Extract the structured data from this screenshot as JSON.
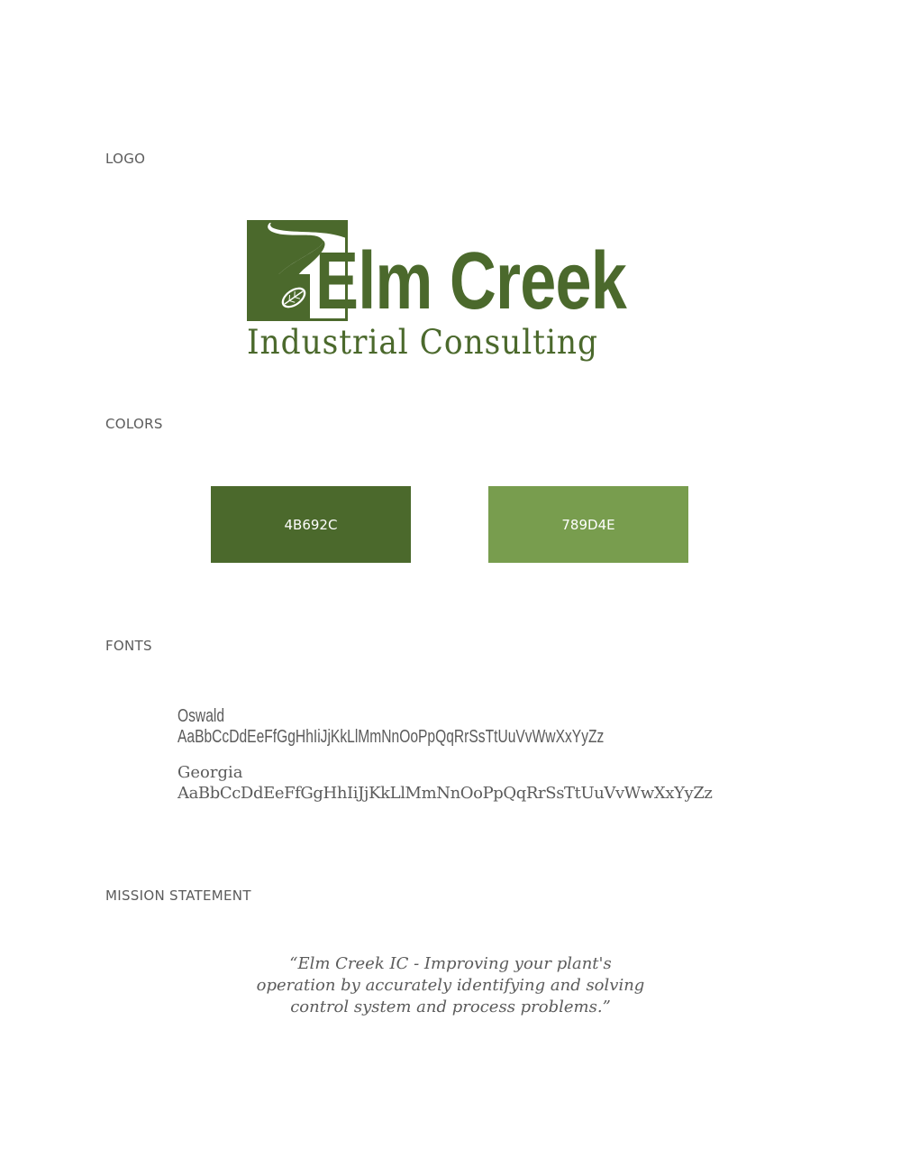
{
  "sections": {
    "logo": "LOGO",
    "colors": "COLORS",
    "fonts": "FONTS",
    "mission": "MISSION STATEMENT"
  },
  "logo": {
    "title": "Elm Creek",
    "subtitle": "Industrial Consulting",
    "mark_icon": "creek-leaf-icon"
  },
  "colors": [
    {
      "label": "4B692C",
      "hex": "#4B692C"
    },
    {
      "label": "789D4E",
      "hex": "#789D4E"
    }
  ],
  "fonts": {
    "oswald": {
      "name": "Oswald",
      "sample": "AaBbCcDdEeFfGgHhIiJjKkLlMmNnOoPpQqRrSsTtUuVvWwXxYyZz"
    },
    "georgia": {
      "name": "Georgia",
      "sample": "AaBbCcDdEeFfGgHhIiJjKkLlMmNnOoPpQqRrSsTtUuVvWwXxYyZz"
    }
  },
  "mission": {
    "line1": "“Elm Creek IC - Improving your plant's",
    "line2": "operation by accurately identifying and solving",
    "line3": "control system and process problems.”"
  }
}
